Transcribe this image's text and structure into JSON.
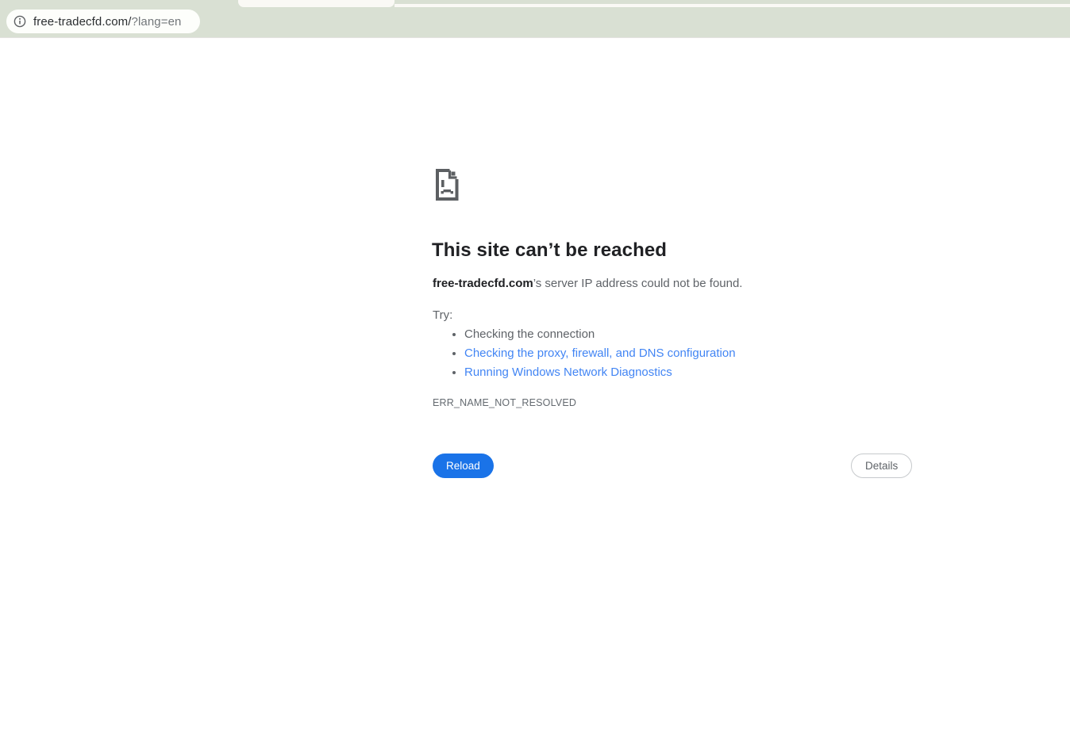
{
  "browser": {
    "url": {
      "main": "free-tradecfd.com/",
      "query": "?lang=en"
    },
    "colors": {
      "toolbar_bg": "#d9e0d3",
      "frame_bg": "#faf9f5",
      "omnibox_bg": "#fdfefb"
    }
  },
  "error_page": {
    "title": "This site can’t be reached",
    "message": {
      "domain": "free-tradecfd.com",
      "rest": "’s server IP address could not be found."
    },
    "try_label": "Try:",
    "suggestions": [
      {
        "label": "Checking the connection",
        "link": false
      },
      {
        "label": "Checking the proxy, firewall, and DNS configuration",
        "link": true
      },
      {
        "label": "Running Windows Network Diagnostics",
        "link": true
      }
    ],
    "error_code": "ERR_NAME_NOT_RESOLVED",
    "reload_label": "Reload",
    "details_label": "Details",
    "colors": {
      "link": "#4285f4",
      "reload_button_bg": "#1a73e8",
      "text_gray": "#5f6368",
      "heading": "#202124",
      "icon_gray": "#5c5f62"
    }
  }
}
